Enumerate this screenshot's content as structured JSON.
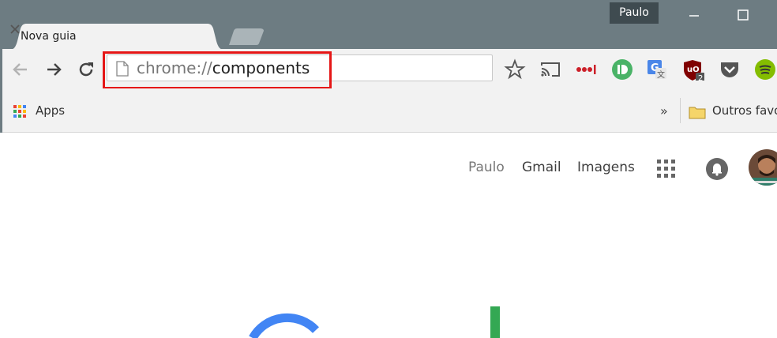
{
  "window": {
    "profile_name": "Paulo",
    "titlebar_color": "#6d7c82"
  },
  "tab": {
    "title": "Nova guia"
  },
  "omnibox": {
    "scheme": "chrome://",
    "path": "components",
    "highlight_color": "#e51616"
  },
  "bookmarks": {
    "apps_label": "Apps",
    "more_label": "»",
    "other_label": "Outros favo"
  },
  "extensions": [
    "cast-icon",
    "lastpass-icon",
    "pushbullet-icon",
    "google-translate-icon",
    "ublock-origin-icon",
    "pocket-icon",
    "spotify-icon"
  ],
  "ublock_badge": "2",
  "google": {
    "user_link": "Paulo",
    "gmail_link": "Gmail",
    "images_link": "Imagens"
  }
}
